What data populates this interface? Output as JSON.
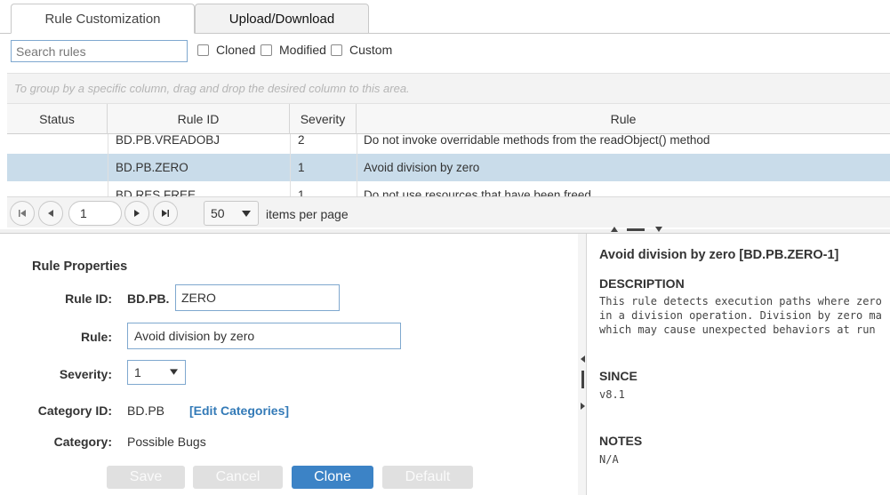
{
  "tabs": [
    {
      "label": "Rule Customization",
      "active": true
    },
    {
      "label": "Upload/Download",
      "active": false
    }
  ],
  "filters": {
    "search_placeholder": "Search rules",
    "checkboxes": [
      {
        "label": "Cloned",
        "checked": false
      },
      {
        "label": "Modified",
        "checked": false
      },
      {
        "label": "Custom",
        "checked": false
      }
    ]
  },
  "grid": {
    "group_hint": "To group by a specific column, drag and drop the desired column to this area.",
    "columns": [
      "Status",
      "Rule ID",
      "Severity",
      "Rule"
    ],
    "rows": [
      {
        "status": "",
        "rule_id": "BD.PB.VREADOBJ",
        "severity": "2",
        "rule": "Do not invoke overridable methods from the readObject() method"
      },
      {
        "status": "",
        "rule_id": "BD.PB.ZERO",
        "severity": "1",
        "rule": "Avoid division by zero",
        "selected": true
      },
      {
        "status": "",
        "rule_id": "BD.RES.FREE",
        "severity": "1",
        "rule": "Do not use resources that have been freed"
      }
    ]
  },
  "pager": {
    "page": "1",
    "page_size": "50",
    "items_label": "items per page"
  },
  "properties": {
    "heading": "Rule Properties",
    "rule_id_label": "Rule ID:",
    "rule_id_prefix": "BD.PB.",
    "rule_id_value": "ZERO",
    "rule_label": "Rule:",
    "rule_value": "Avoid division by zero",
    "severity_label": "Severity:",
    "severity_value": "1",
    "category_id_label": "Category ID:",
    "category_id_value": "BD.PB",
    "edit_categories": "[Edit Categories]",
    "category_label": "Category:",
    "category_value": "Possible Bugs"
  },
  "buttons": {
    "save": "Save",
    "cancel": "Cancel",
    "clone": "Clone",
    "default": "Default"
  },
  "doc": {
    "title": "Avoid division by zero [BD.PB.ZERO-1]",
    "description_heading": "DESCRIPTION",
    "description_lines": [
      "This rule detects execution paths where zero",
      "in a division operation. Division by zero ma",
      "which may cause unexpected behaviors at run"
    ],
    "since_heading": "SINCE",
    "since_value": "v8.1",
    "notes_heading": "NOTES",
    "notes_value": "N/A"
  },
  "colors": {
    "accent": "#3c83c6",
    "selected_row": "#c9dcea",
    "link": "#337ab7"
  }
}
